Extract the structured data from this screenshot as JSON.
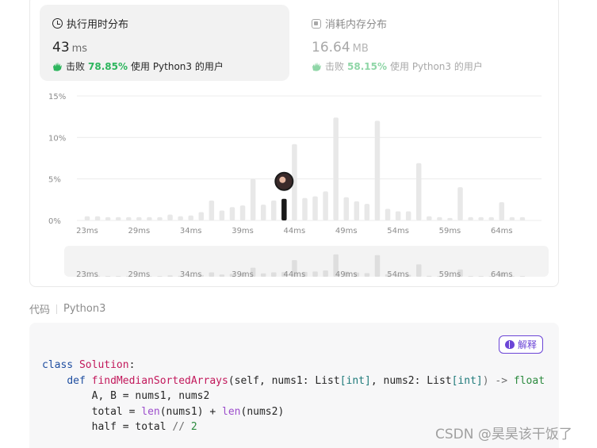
{
  "runtime": {
    "title": "执行用时分布",
    "value": "43",
    "unit": "ms",
    "beat_prefix": "击败",
    "beat_pct": "78.85%",
    "beat_suffix": "使用 Python3 的用户"
  },
  "memory": {
    "title": "消耗内存分布",
    "value": "16.64",
    "unit": "MB",
    "beat_prefix": "击败",
    "beat_pct": "58.15%",
    "beat_suffix": "使用 Python3 的用户"
  },
  "chart_data": {
    "type": "bar",
    "title": "",
    "xlabel": "",
    "ylabel": "",
    "y_ticks": [
      "15%",
      "10%",
      "5%",
      "0%"
    ],
    "ylim": [
      0,
      15
    ],
    "x_tick_labels": [
      "23ms",
      "29ms",
      "34ms",
      "39ms",
      "44ms",
      "49ms",
      "54ms",
      "59ms",
      "64ms"
    ],
    "values": [
      0.5,
      0.5,
      0.4,
      0.4,
      0.4,
      0.4,
      0.4,
      0.4,
      0.7,
      0.5,
      0.6,
      1.0,
      2.4,
      1.2,
      1.6,
      1.8,
      5.0,
      1.9,
      2.4,
      2.6,
      9.2,
      2.7,
      2.9,
      3.5,
      12.4,
      2.8,
      2.3,
      2.0,
      12.0,
      1.4,
      1.1,
      1.1,
      6.9,
      0.5,
      0.4,
      0.3,
      4.0,
      0.4,
      0.4,
      0.4,
      2.2,
      0.4,
      0.4
    ],
    "highlight_index": 19,
    "grid": true,
    "colors": {
      "bar": "#e8e8e8",
      "highlight": "#1a1a1a",
      "grid": "#ececec"
    }
  },
  "navigator": {
    "tick_labels": [
      "23ms",
      "29ms",
      "34ms",
      "39ms",
      "44ms",
      "49ms",
      "54ms",
      "59ms",
      "64ms"
    ]
  },
  "code_section": {
    "label": "代码",
    "language": "Python3",
    "explain_label": "解释"
  },
  "code": {
    "l1_kw": "class",
    "l1_name": "Solution",
    "l1_colon": ":",
    "l2_kw": "def",
    "l2_fn": "findMedianSortedArrays",
    "l2_open": "(self, nums1: ",
    "l2_t1": "List",
    "l2_b1": "[int]",
    "l2_mid": ", nums2: ",
    "l2_t2": "List",
    "l2_b2": "[int]",
    "l2_close": ") -> ",
    "l2_ret": "float",
    "l3": "A, B = nums1, nums2",
    "l4_a": "total = ",
    "l4_len1": "len",
    "l4_b": "(nums1) + ",
    "l4_len2": "len",
    "l4_c": "(nums2)",
    "l5_a": "half = total ",
    "l5_op": "//",
    "l5_num": "2"
  },
  "watermark": "CSDN @昊昊该干饭了"
}
